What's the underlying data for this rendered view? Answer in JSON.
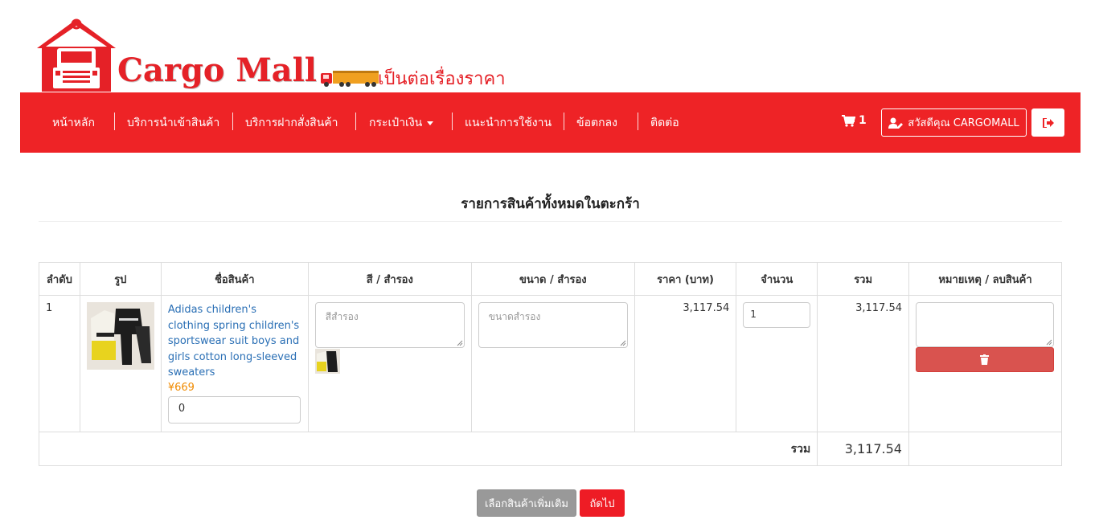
{
  "brand": {
    "name": "Cargo Mall",
    "slogan": "เป็นต่อเรื่องราคา",
    "color": "#e52127"
  },
  "nav": {
    "items": [
      {
        "label": "หน้าหลัก"
      },
      {
        "label": "บริการนำเข้าสินค้า"
      },
      {
        "label": "บริการฝากสั่งสินค้า"
      },
      {
        "label": "กระเป๋าเงิน"
      },
      {
        "label": "แนะนำการใช้งาน"
      },
      {
        "label": "ข้อตกลง"
      },
      {
        "label": "ติดต่อ"
      }
    ],
    "cart_count": "1",
    "cart_icon": "cart-icon",
    "user_label": "สวัสดีคุณ CARGOMALL",
    "user_icon": "user-edit-icon",
    "logout_icon": "sign-out-icon",
    "bg_color": "#ee2326"
  },
  "page": {
    "title": "รายการสินค้าทั้งหมดในตะกร้า"
  },
  "table": {
    "headers": [
      "ลำดับ",
      "รูป",
      "ชื่อสินค้า",
      "สี / สำรอง",
      "ขนาด / สำรอง",
      "ราคา (บาท)",
      "จำนวน",
      "รวม",
      "หมายเหตุ / ลบสินค้า"
    ],
    "rows": [
      {
        "index": "1",
        "name": "Adidas children's clothing spring children's sportswear suit boys and girls cotton long-sleeved sweaters",
        "price_cny": "¥669",
        "extra_value": "0",
        "color_placeholder": "สีสำรอง",
        "size_placeholder": "ขนาดสำรอง",
        "price": "3,117.54",
        "qty": "1",
        "total": "3,117.54",
        "note": "",
        "delete_icon": "trash-icon"
      }
    ],
    "total_label": "รวม",
    "total_value": "3,117.54"
  },
  "actions": {
    "more_label": "เลือกสินค้าเพิ่มเติม",
    "next_label": "ถัดไป"
  }
}
